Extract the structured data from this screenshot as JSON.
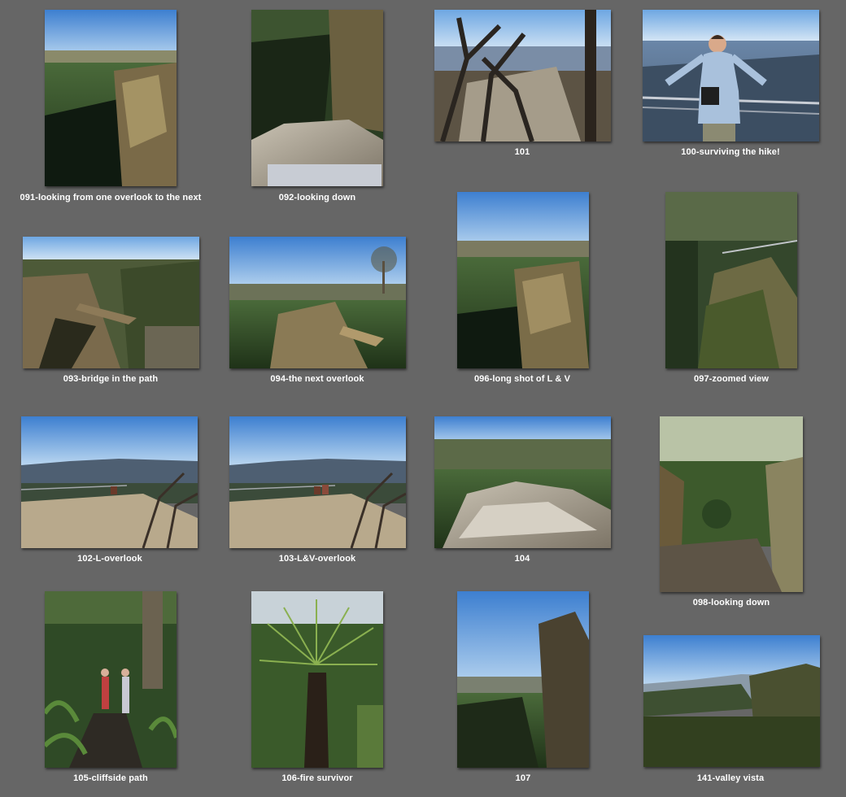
{
  "photos": [
    {
      "caption": "091-looking from one overlook to the next"
    },
    {
      "caption": "092-looking down"
    },
    {
      "caption": "101"
    },
    {
      "caption": "100-surviving the hike!"
    },
    {
      "caption": "093-bridge in the path"
    },
    {
      "caption": "094-the next overlook"
    },
    {
      "caption": "096-long shot of L & V"
    },
    {
      "caption": "097-zoomed view"
    },
    {
      "caption": "102-L-overlook"
    },
    {
      "caption": "103-L&V-overlook"
    },
    {
      "caption": "104"
    },
    {
      "caption": "098-looking down"
    },
    {
      "caption": "105-cliffside path"
    },
    {
      "caption": "106-fire survivor"
    },
    {
      "caption": "107"
    },
    {
      "caption": "141-valley vista"
    }
  ]
}
